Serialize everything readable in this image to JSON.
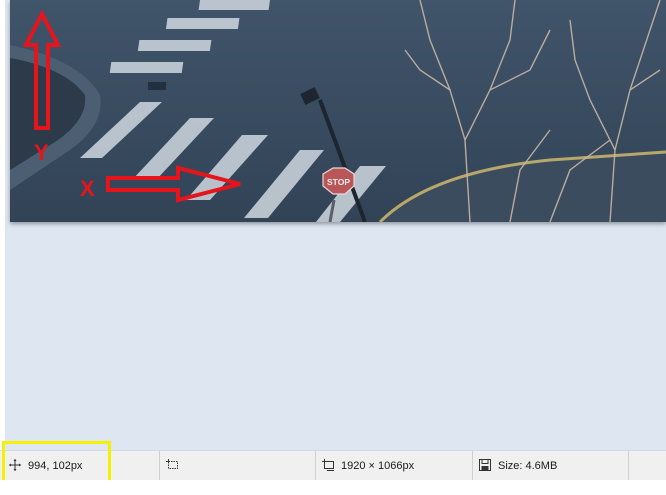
{
  "canvas": {
    "annotations": {
      "y_axis_label": "Y",
      "x_axis_label": "X",
      "arrow_color": "#e8141b"
    },
    "stop_sign_text": "STOP"
  },
  "statusbar": {
    "cursor_position": "994, 102px",
    "cursor_icon": "move-crosshair-icon",
    "selection_icon": "selection-icon",
    "image_dimensions": "1920 × 1066px",
    "dimensions_icon": "image-dimensions-icon",
    "file_size": "Size: 4.6MB",
    "size_icon": "save-disk-icon",
    "highlight_color": "#f4f000"
  }
}
